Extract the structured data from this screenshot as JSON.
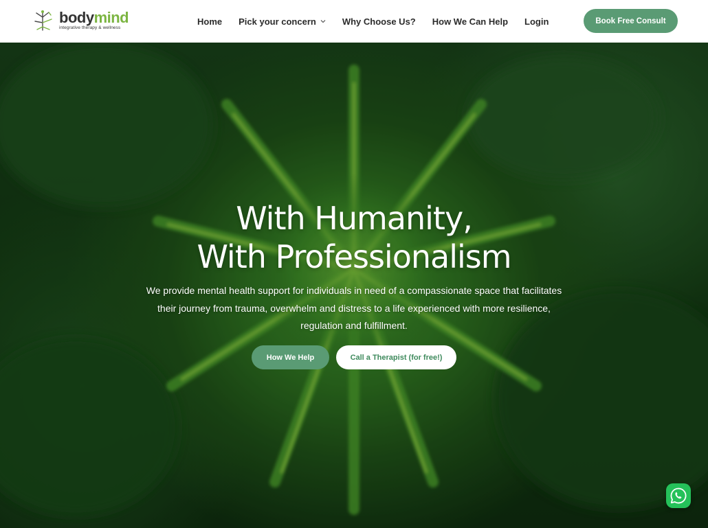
{
  "brand": {
    "name_part1": "body",
    "name_part2": "mind",
    "tagline": "integrative therapy & wellness",
    "logo_icon": "tree-figure-icon",
    "colors": {
      "dark": "#333333",
      "green": "#7cb542"
    }
  },
  "nav": {
    "items": [
      {
        "label": "Home"
      },
      {
        "label": "Pick your concern",
        "has_dropdown": true
      },
      {
        "label": "Why Choose Us?"
      },
      {
        "label": "How We Can Help"
      },
      {
        "label": "Login"
      }
    ],
    "cta_label": "Book Free Consult"
  },
  "hero": {
    "title_line1": "With Humanity,",
    "title_line2": "With Professionalism",
    "description": "We provide mental health support for individuals in need of a compassionate space that facilitates their journey from trauma, overwhelm and distress to a life experienced with more resilience, regulation and fulfillment.",
    "primary_button": "How We Help",
    "secondary_button": "Call a Therapist (for free!)",
    "background_image": "green fern / pine branch close-up"
  },
  "floating": {
    "whatsapp_icon": "whatsapp-icon"
  },
  "colors": {
    "accent": "#5a9b74",
    "accent_text": "#3e8a5c",
    "whatsapp": "#25c15a"
  }
}
